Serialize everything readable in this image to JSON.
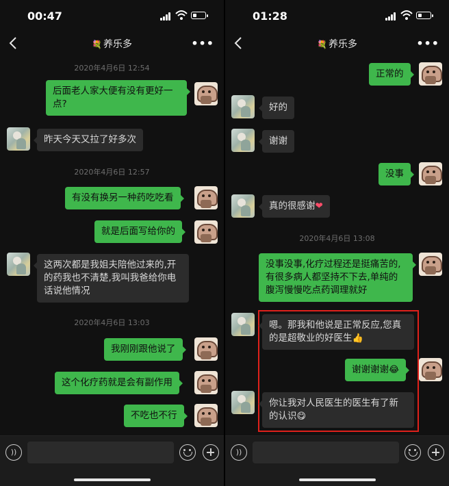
{
  "left": {
    "status": {
      "time": "00:47"
    },
    "nav": {
      "flower": "💐",
      "title": "养乐多",
      "more": "•••"
    },
    "timestamps": [
      "2020年4月6日 12:54",
      "2020年4月6日 12:57",
      "2020年4月6日 13:03"
    ],
    "messages": [
      {
        "text": "后面老人家大便有没有更好一点?"
      },
      {
        "text": "昨天今天又拉了好多次"
      },
      {
        "text": "有没有换另一种药吃吃看"
      },
      {
        "text": "就是后面写给你的"
      },
      {
        "text": "这两次都是我姐夫陪他过来的,开的药我也不清楚,我叫我爸给你电话说他情况"
      },
      {
        "text": "我刚刚跟他说了"
      },
      {
        "text": "这个化疗药就是会有副作用"
      },
      {
        "text": "不吃也不行"
      }
    ]
  },
  "right": {
    "status": {
      "time": "01:28"
    },
    "nav": {
      "flower": "💐",
      "title": "养乐多",
      "more": "•••"
    },
    "timestamps": [
      "2020年4月6日 13:08"
    ],
    "messages": [
      {
        "text": "正常的"
      },
      {
        "text": "好的"
      },
      {
        "text": "谢谢"
      },
      {
        "text": "没事"
      },
      {
        "text": "真的很感谢",
        "emoji": "❤"
      },
      {
        "text": "没事没事,化疗过程还是挺痛苦的,有很多病人都坚持不下去,单纯的腹泻慢慢吃点药调理就好"
      },
      {
        "text": "嗯。那我和他说是正常反应,您真的是超敬业的好医生",
        "emoji": "👍"
      },
      {
        "text": "谢谢谢谢",
        "emoji": "😂"
      },
      {
        "text": "你让我对人民医生的医生有了新的认识",
        "emoji": "😋"
      }
    ]
  },
  "colors": {
    "outgoing": "#3fb74c",
    "incoming": "#2c2c2c",
    "highlight": "#e0211b",
    "background": "#111111"
  }
}
